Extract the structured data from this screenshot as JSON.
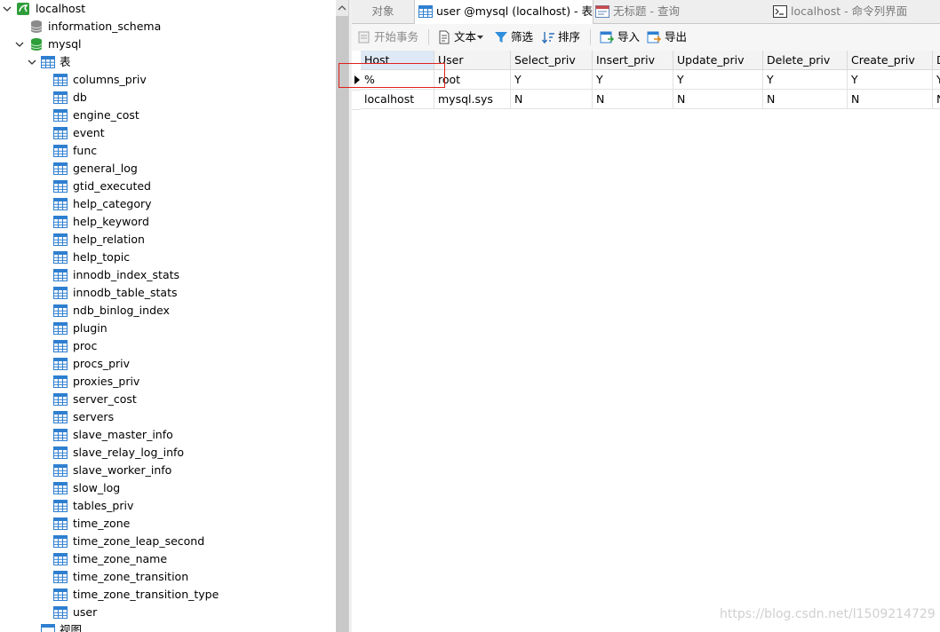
{
  "tree": {
    "connection": "localhost",
    "databases": [
      "information_schema",
      "mysql"
    ],
    "tables_folder": "表",
    "tables": [
      "columns_priv",
      "db",
      "engine_cost",
      "event",
      "func",
      "general_log",
      "gtid_executed",
      "help_category",
      "help_keyword",
      "help_relation",
      "help_topic",
      "innodb_index_stats",
      "innodb_table_stats",
      "ndb_binlog_index",
      "plugin",
      "proc",
      "procs_priv",
      "proxies_priv",
      "server_cost",
      "servers",
      "slave_master_info",
      "slave_relay_log_info",
      "slave_worker_info",
      "slow_log",
      "tables_priv",
      "time_zone",
      "time_zone_leap_second",
      "time_zone_name",
      "time_zone_transition",
      "time_zone_transition_type",
      "user"
    ],
    "views_folder": "视图"
  },
  "tabs": {
    "objects": "对象",
    "user_table": "user @mysql (localhost) - 表",
    "query": "无标题 - 查询",
    "console": "localhost - 命令列界面"
  },
  "toolbar": {
    "begin_transaction": "开始事务",
    "text": "文本",
    "filter": "筛选",
    "sort": "排序",
    "import": "导入",
    "export": "导出"
  },
  "grid": {
    "columns": [
      "Host",
      "User",
      "Select_priv",
      "Insert_priv",
      "Update_priv",
      "Delete_priv",
      "Create_priv",
      "D"
    ],
    "rows": [
      [
        "%",
        "root",
        "Y",
        "Y",
        "Y",
        "Y",
        "Y",
        "Y"
      ],
      [
        "localhost",
        "mysql.sys",
        "N",
        "N",
        "N",
        "N",
        "N",
        "N"
      ]
    ]
  },
  "watermark": "https://blog.csdn.net/l1509214729",
  "colors": {
    "highlight": "#e0201c",
    "db_icon": "#2e9e3a",
    "table_icon": "#2f7fd0"
  }
}
